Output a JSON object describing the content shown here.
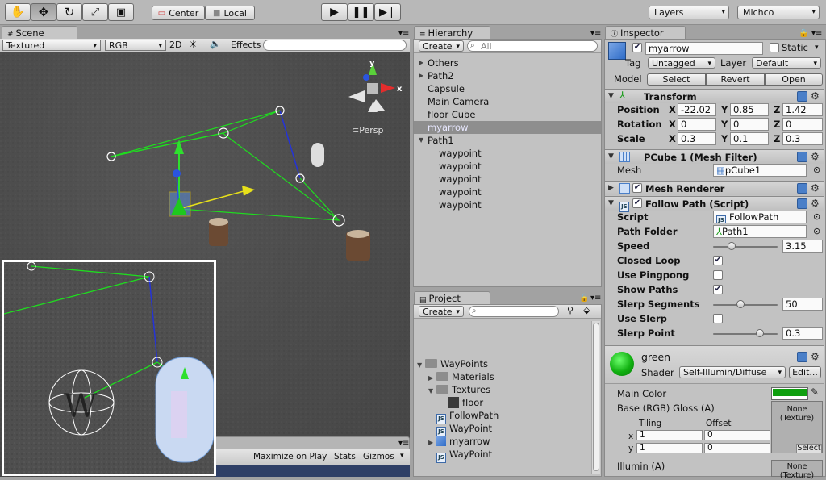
{
  "toolbar": {
    "tools": [
      "hand-icon",
      "move-icon",
      "rotate-icon",
      "scale-icon",
      "rect-icon"
    ],
    "pivot_label": "Center",
    "space_label": "Local",
    "layers_label": "Layers",
    "layout_label": "Michco"
  },
  "scene": {
    "tab_label": "Scene",
    "render_mode": "Textured",
    "color_mode": "RGB",
    "mode_2d": "2D",
    "effects_label": "Effects",
    "persp_label": "Persp",
    "game_bar": {
      "maximize_label": "Maximize on Play",
      "stats_label": "Stats",
      "gizmos_label": "Gizmos"
    }
  },
  "hierarchy": {
    "tab_label": "Hierarchy",
    "create_label": "Create",
    "search_placeholder": "All",
    "items": [
      {
        "label": "Others",
        "indent": 0,
        "expandable": true,
        "selected": false
      },
      {
        "label": "Path2",
        "indent": 0,
        "expandable": true,
        "selected": false
      },
      {
        "label": "Capsule",
        "indent": 0,
        "expandable": false,
        "selected": false
      },
      {
        "label": "Main Camera",
        "indent": 0,
        "expandable": false,
        "selected": false
      },
      {
        "label": "floor Cube",
        "indent": 0,
        "expandable": false,
        "selected": false
      },
      {
        "label": "myarrow",
        "indent": 0,
        "expandable": false,
        "selected": true
      },
      {
        "label": "Path1",
        "indent": 0,
        "expandable": true,
        "expanded": true,
        "selected": false
      },
      {
        "label": "waypoint",
        "indent": 1,
        "expandable": false,
        "selected": false
      },
      {
        "label": "waypoint",
        "indent": 1,
        "expandable": false,
        "selected": false
      },
      {
        "label": "waypoint",
        "indent": 1,
        "expandable": false,
        "selected": false
      },
      {
        "label": "waypoint",
        "indent": 1,
        "expandable": false,
        "selected": false
      },
      {
        "label": "waypoint",
        "indent": 1,
        "expandable": false,
        "selected": false
      }
    ]
  },
  "project": {
    "tab_label": "Project",
    "create_label": "Create",
    "items": [
      {
        "label": "WayPoints",
        "type": "folder",
        "indent": 0,
        "expanded": true
      },
      {
        "label": "Materials",
        "type": "folder",
        "indent": 1,
        "expandable": true
      },
      {
        "label": "Textures",
        "type": "folder",
        "indent": 1,
        "expanded": true
      },
      {
        "label": "floor",
        "type": "texture",
        "indent": 2
      },
      {
        "label": "FollowPath",
        "type": "script",
        "indent": 1
      },
      {
        "label": "WayPoint",
        "type": "script",
        "indent": 1
      },
      {
        "label": "myarrow",
        "type": "prefab",
        "indent": 1,
        "expandable": true
      },
      {
        "label": "WayPoint",
        "type": "script",
        "indent": 1
      }
    ]
  },
  "inspector": {
    "tab_label": "Inspector",
    "object_name": "myarrow",
    "static_label": "Static",
    "tag_label": "Tag",
    "tag_value": "Untagged",
    "layer_label": "Layer",
    "layer_value": "Default",
    "model_label": "Model",
    "model_buttons": [
      "Select",
      "Revert",
      "Open"
    ],
    "transform": {
      "title": "Transform",
      "rows": [
        {
          "label": "Position",
          "x": "-22.02",
          "y": "0.85",
          "z": "1.42"
        },
        {
          "label": "Rotation",
          "x": "0",
          "y": "0",
          "z": "0"
        },
        {
          "label": "Scale",
          "x": "0.3",
          "y": "0.1",
          "z": "0.3"
        }
      ]
    },
    "mesh_filter": {
      "title": "PCube 1 (Mesh Filter)",
      "mesh_label": "Mesh",
      "mesh_value": "pCube1"
    },
    "mesh_renderer": {
      "title": "Mesh Renderer"
    },
    "follow_path": {
      "title": "Follow Path (Script)",
      "script_label": "Script",
      "script_value": "FollowPath",
      "path_folder_label": "Path Folder",
      "path_folder_value": "Path1",
      "speed_label": "Speed",
      "speed_value": "3.15",
      "speed_slider": 0.26,
      "closed_loop_label": "Closed Loop",
      "closed_loop": true,
      "use_pingpong_label": "Use Pingpong",
      "use_pingpong": false,
      "show_paths_label": "Show Paths",
      "show_paths": true,
      "slerp_segments_label": "Slerp Segments",
      "slerp_segments_value": "50",
      "slerp_segments_slider": 0.42,
      "use_slerp_label": "Use Slerp",
      "use_slerp": false,
      "slerp_point_label": "Slerp Point",
      "slerp_point_value": "0.3",
      "slerp_point_slider": 0.75
    },
    "material": {
      "name": "green",
      "shader_label": "Shader",
      "shader_value": "Self-Illumin/Diffuse",
      "edit_label": "Edit...",
      "main_color_label": "Main Color",
      "main_color": "#0f9f0f",
      "base_label": "Base (RGB) Gloss (A)",
      "tiling_label": "Tiling",
      "offset_label": "Offset",
      "x_label": "x",
      "y_label": "y",
      "tiling_x": "1",
      "tiling_y": "1",
      "offset_x": "0",
      "offset_y": "0",
      "none_texture": "None\n(Texture)",
      "select_label": "Select",
      "illumin_label": "Illumin (A)",
      "none_texture2": "None\n(Texture)"
    }
  }
}
